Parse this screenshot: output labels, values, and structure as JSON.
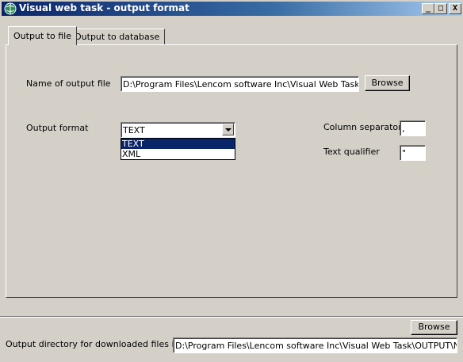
{
  "window": {
    "title": "Visual web task - output format",
    "controls": {
      "minimize": "_",
      "maximize": "□",
      "close": "X"
    }
  },
  "tabs": [
    {
      "label": "Output to file",
      "active": true
    },
    {
      "label": "Output to database",
      "active": false
    }
  ],
  "file_tab": {
    "output_file_label": "Name of output file",
    "output_file_value": "D:\\Program Files\\Lencom software Inc\\Visual Web Task\\OU",
    "browse_label": "Browse",
    "output_format_label": "Output format",
    "output_format_value": "TEXT",
    "output_format_options": [
      "TEXT",
      "XML"
    ],
    "column_separator_label": "Column separator",
    "column_separator_value": ",",
    "text_qualifier_label": "Text qualifier",
    "text_qualifier_value": "\""
  },
  "footer": {
    "browse_label": "Browse",
    "output_dir_label": "Output directory for downloaded files if any",
    "output_dir_value": "D:\\Program Files\\Lencom software Inc\\Visual Web Task\\OUTPUT\\New"
  },
  "icons": {
    "app": "globe-app-icon",
    "dropdown": "chevron-down-icon"
  },
  "colors": {
    "titlebar_start": "#0a246a",
    "titlebar_end": "#a6caf0",
    "face": "#d4d0c8",
    "selection": "#0a246a"
  }
}
